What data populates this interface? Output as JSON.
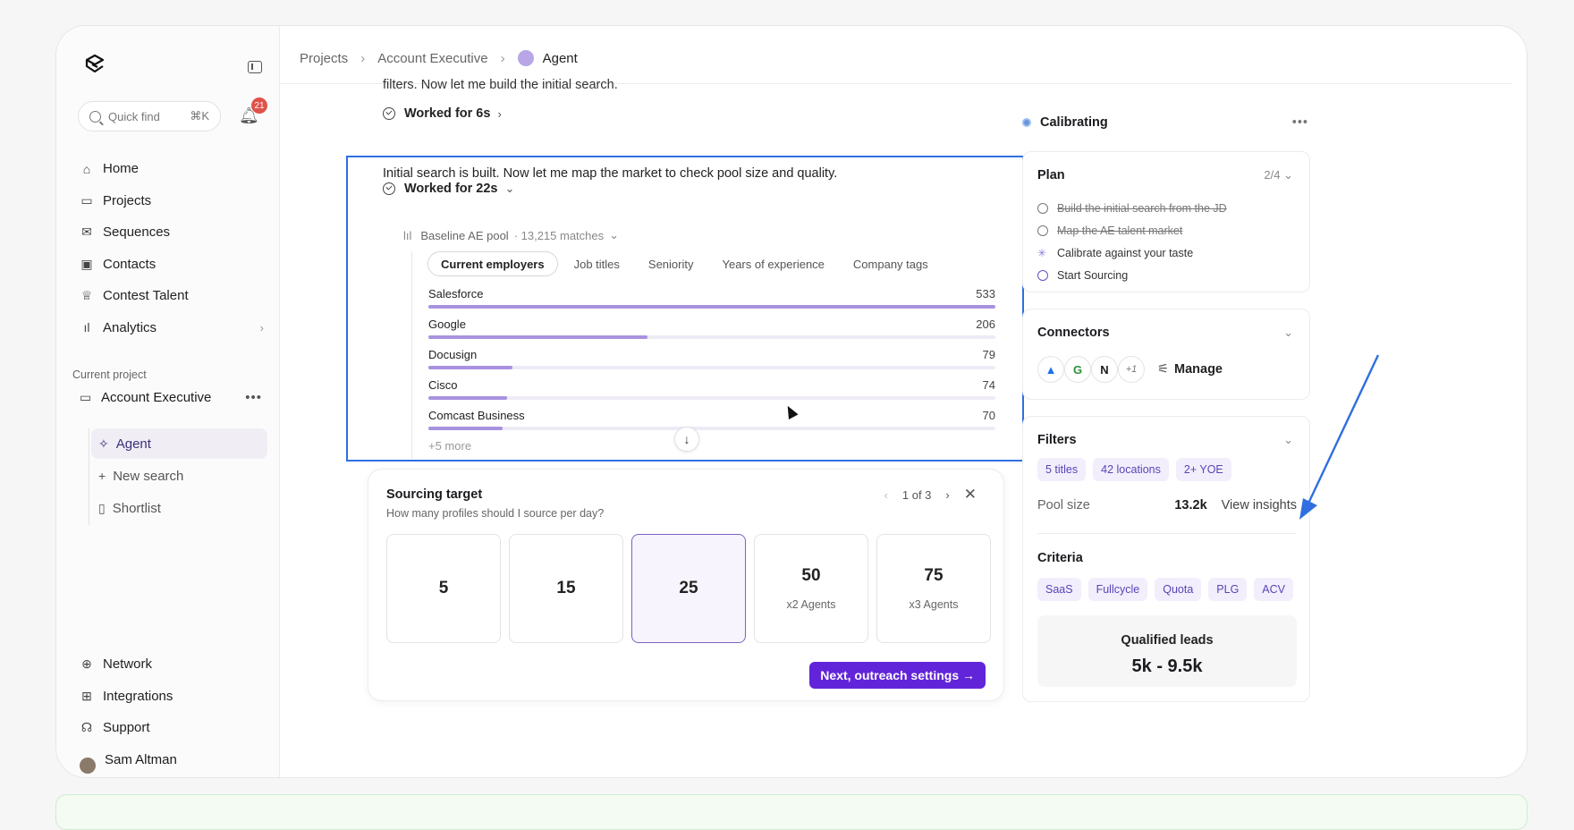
{
  "sidebar": {
    "quick_find": "Quick find",
    "quick_find_shortcut": "⌘K",
    "notifications_count": "21",
    "nav": [
      {
        "label": "Home",
        "icon": "home-icon"
      },
      {
        "label": "Projects",
        "icon": "folder-icon"
      },
      {
        "label": "Sequences",
        "icon": "mail-icon"
      },
      {
        "label": "Contacts",
        "icon": "contact-icon"
      },
      {
        "label": "Contest Talent",
        "icon": "trophy-icon"
      },
      {
        "label": "Analytics",
        "icon": "bar-chart-icon"
      }
    ],
    "current_project_label": "Current project",
    "project_name": "Account Executive",
    "sub_items": [
      {
        "label": "Agent",
        "icon": "sparkle-icon"
      },
      {
        "label": "New search",
        "icon": "plus-icon"
      },
      {
        "label": "Shortlist",
        "icon": "bookmark-icon"
      }
    ],
    "bottom_nav": [
      {
        "label": "Network",
        "icon": "globe-icon"
      },
      {
        "label": "Integrations",
        "icon": "grid-icon"
      },
      {
        "label": "Support",
        "icon": "headset-icon"
      }
    ],
    "user_name": "Sam Altman"
  },
  "breadcrumbs": [
    "Projects",
    "Account Executive",
    "Agent"
  ],
  "chat": {
    "cut_text": "filters. Now let me build the initial search.",
    "worked_1": "Worked for 6s",
    "message": "Initial search is built. Now let me map the market to check pool size and quality.",
    "worked_2": "Worked for 22s",
    "baseline_label": "Baseline AE pool",
    "baseline_count": "· 13,215 matches",
    "tabs": [
      "Current employers",
      "Job titles",
      "Seniority",
      "Years of experience",
      "Company tags"
    ],
    "employers": [
      {
        "name": "Salesforce",
        "value": 533
      },
      {
        "name": "Google",
        "value": 206
      },
      {
        "name": "Docusign",
        "value": 79
      },
      {
        "name": "Cisco",
        "value": 74
      },
      {
        "name": "Comcast Business",
        "value": 70
      }
    ],
    "more": "+5 more"
  },
  "sourcing": {
    "title": "Sourcing target",
    "subtitle": "How many profiles should I source per day?",
    "pager": "1 of 3",
    "options": [
      {
        "num": "5",
        "sub": ""
      },
      {
        "num": "15",
        "sub": ""
      },
      {
        "num": "25",
        "sub": ""
      },
      {
        "num": "50",
        "sub": "x2 Agents"
      },
      {
        "num": "75",
        "sub": "x3 Agents"
      }
    ],
    "selected": "25",
    "next_label": "Next, outreach settings →"
  },
  "right": {
    "status": "Calibrating",
    "plan_title": "Plan",
    "plan_progress": "2/4",
    "plan_items": [
      {
        "label": "Build the initial search from the JD",
        "state": "done"
      },
      {
        "label": "Map the AE talent market",
        "state": "done"
      },
      {
        "label": "Calibrate against your taste",
        "state": "in-progress"
      },
      {
        "label": "Start Sourcing",
        "state": "todo"
      }
    ],
    "connectors_title": "Connectors",
    "connectors_more": "+1",
    "manage_label": "Manage",
    "filters_title": "Filters",
    "filter_chips": [
      "5 titles",
      "42 locations",
      "2+ YOE"
    ],
    "pool_size_label": "Pool size",
    "pool_size_value": "13.2k",
    "view_insights": "View insights",
    "criteria_title": "Criteria",
    "criteria_chips": [
      "SaaS",
      "Fullcycle",
      "Quota",
      "PLG",
      "ACV"
    ],
    "leads_title": "Qualified leads",
    "leads_value": "5k - 9.5k"
  },
  "colors": {
    "accent": "#6224d9",
    "highlight_box": "#2f6fe0",
    "bar_fill": "#a892e0"
  }
}
